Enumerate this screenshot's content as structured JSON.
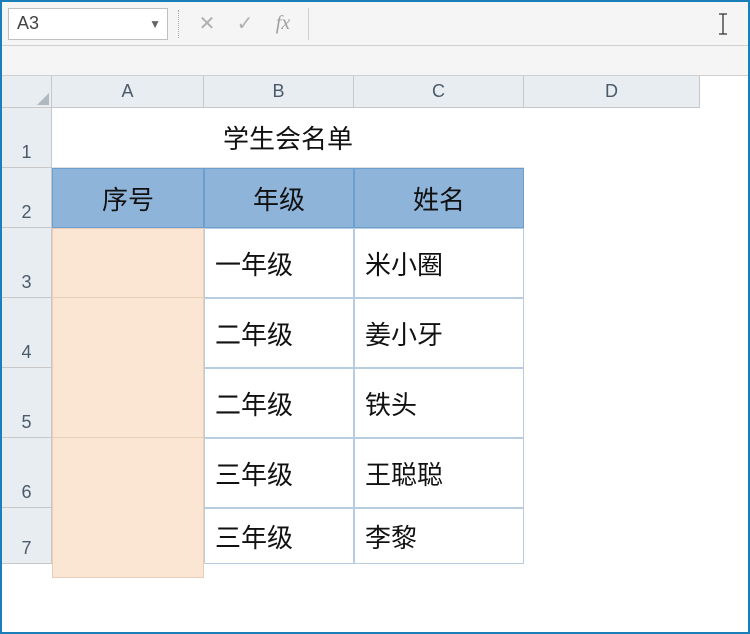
{
  "name_box": "A3",
  "formula_input": "",
  "columns": [
    "A",
    "B",
    "C",
    "D"
  ],
  "rows": [
    "1",
    "2",
    "3",
    "4",
    "5",
    "6",
    "7"
  ],
  "sheet": {
    "title": "学生会名单",
    "headers": {
      "a": "序号",
      "b": "年级",
      "c": "姓名"
    },
    "data": [
      {
        "grade": "一年级",
        "name": "米小圈"
      },
      {
        "grade": "二年级",
        "name": "姜小牙"
      },
      {
        "grade": "二年级",
        "name": "铁头"
      },
      {
        "grade": "三年级",
        "name": "王聪聪"
      },
      {
        "grade": "三年级",
        "name": "李黎"
      }
    ]
  }
}
